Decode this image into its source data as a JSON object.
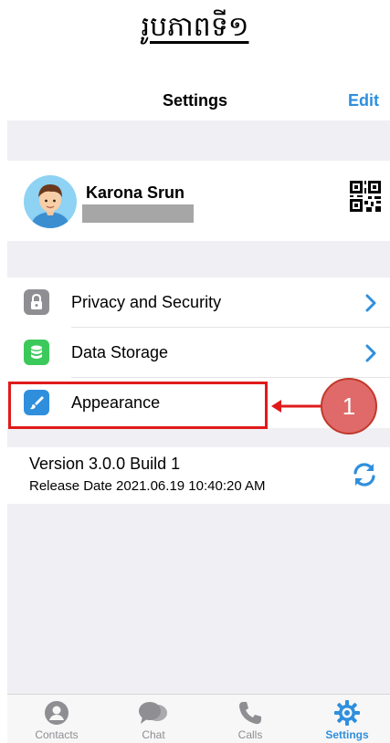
{
  "caption": {
    "text": "រូបភាពទី១"
  },
  "nav": {
    "title": "Settings",
    "edit_label": "Edit"
  },
  "profile": {
    "name": "Karona Srun"
  },
  "menu": {
    "items": [
      {
        "label": "Privacy and Security",
        "icon": "lock-icon",
        "color": "#8e8e93"
      },
      {
        "label": "Data Storage",
        "icon": "database-icon",
        "color": "#3cc95b"
      },
      {
        "label": "Appearance",
        "icon": "paintbrush-icon",
        "color": "#2f8fdd"
      }
    ]
  },
  "annotation": {
    "step": "1",
    "color": "#e01a1a"
  },
  "version": {
    "title": "Version 3.0.0 Build 1",
    "release": "Release Date 2021.06.19 10:40:20 AM"
  },
  "tabs": [
    {
      "label": "Contacts"
    },
    {
      "label": "Chat"
    },
    {
      "label": "Calls"
    },
    {
      "label": "Settings",
      "active": true
    }
  ],
  "colors": {
    "accent": "#2f8fdd",
    "background": "#efeff4"
  }
}
